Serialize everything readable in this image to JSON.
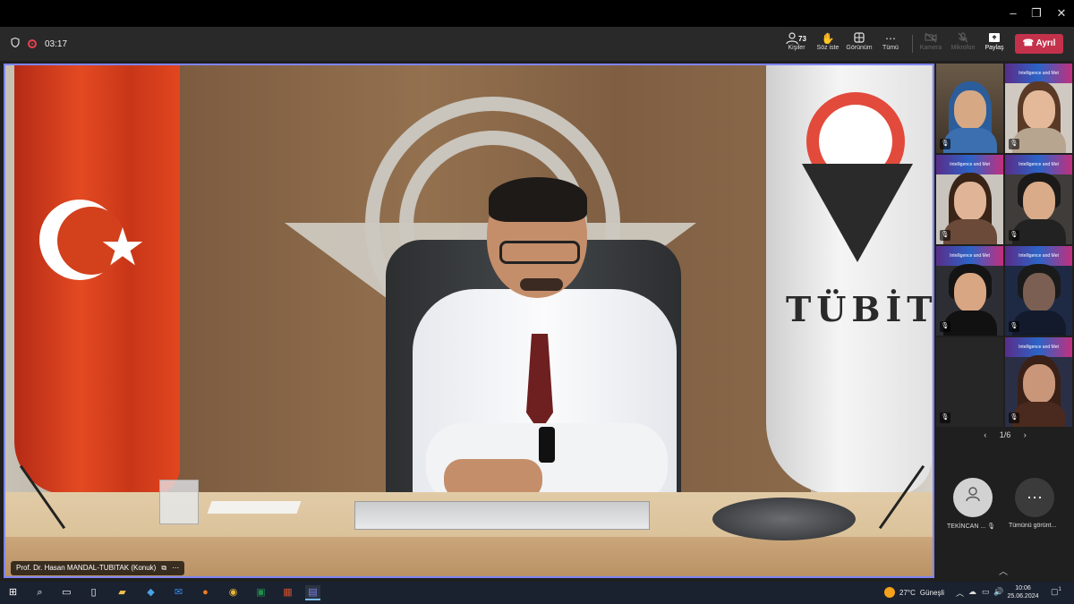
{
  "window": {
    "minimize": "–",
    "restore": "❐",
    "close": "✕"
  },
  "toolbar": {
    "shield_icon": "shield-icon",
    "timer": "03:17",
    "people": {
      "label": "Kişiler",
      "count": "73"
    },
    "raise_hand": {
      "label": "Söz iste"
    },
    "view": {
      "label": "Görünüm"
    },
    "more": {
      "label": "Tümü"
    },
    "camera": {
      "label": "Kamera"
    },
    "microphone": {
      "label": "Mikrofon"
    },
    "share": {
      "label": "Paylaş"
    },
    "leave": {
      "label": "Ayrıl"
    },
    "colors": {
      "leave": "#c4314b",
      "record": "#e2434d",
      "active_border": "#7f85f5"
    }
  },
  "main_video": {
    "speaker_name": "Prof. Dr. Hasan MANDAL-TUBITAK (Konuk)",
    "more": "⋯",
    "flag_text": "TÜBİTA"
  },
  "gallery": {
    "banner_text": "Intelligence and Met",
    "pager": {
      "current": "1/6",
      "prev": "‹",
      "next": "›"
    },
    "avatar_user_label": "TEKİNCAN ...",
    "show_all_label": "Tümünü görünt...",
    "show_all_icon": "⋯"
  },
  "taskbar": {
    "weather_temp": "27°C",
    "weather_label": "Güneşli",
    "time": "10:06",
    "date": "25.06.2024",
    "notification_count": "1"
  }
}
